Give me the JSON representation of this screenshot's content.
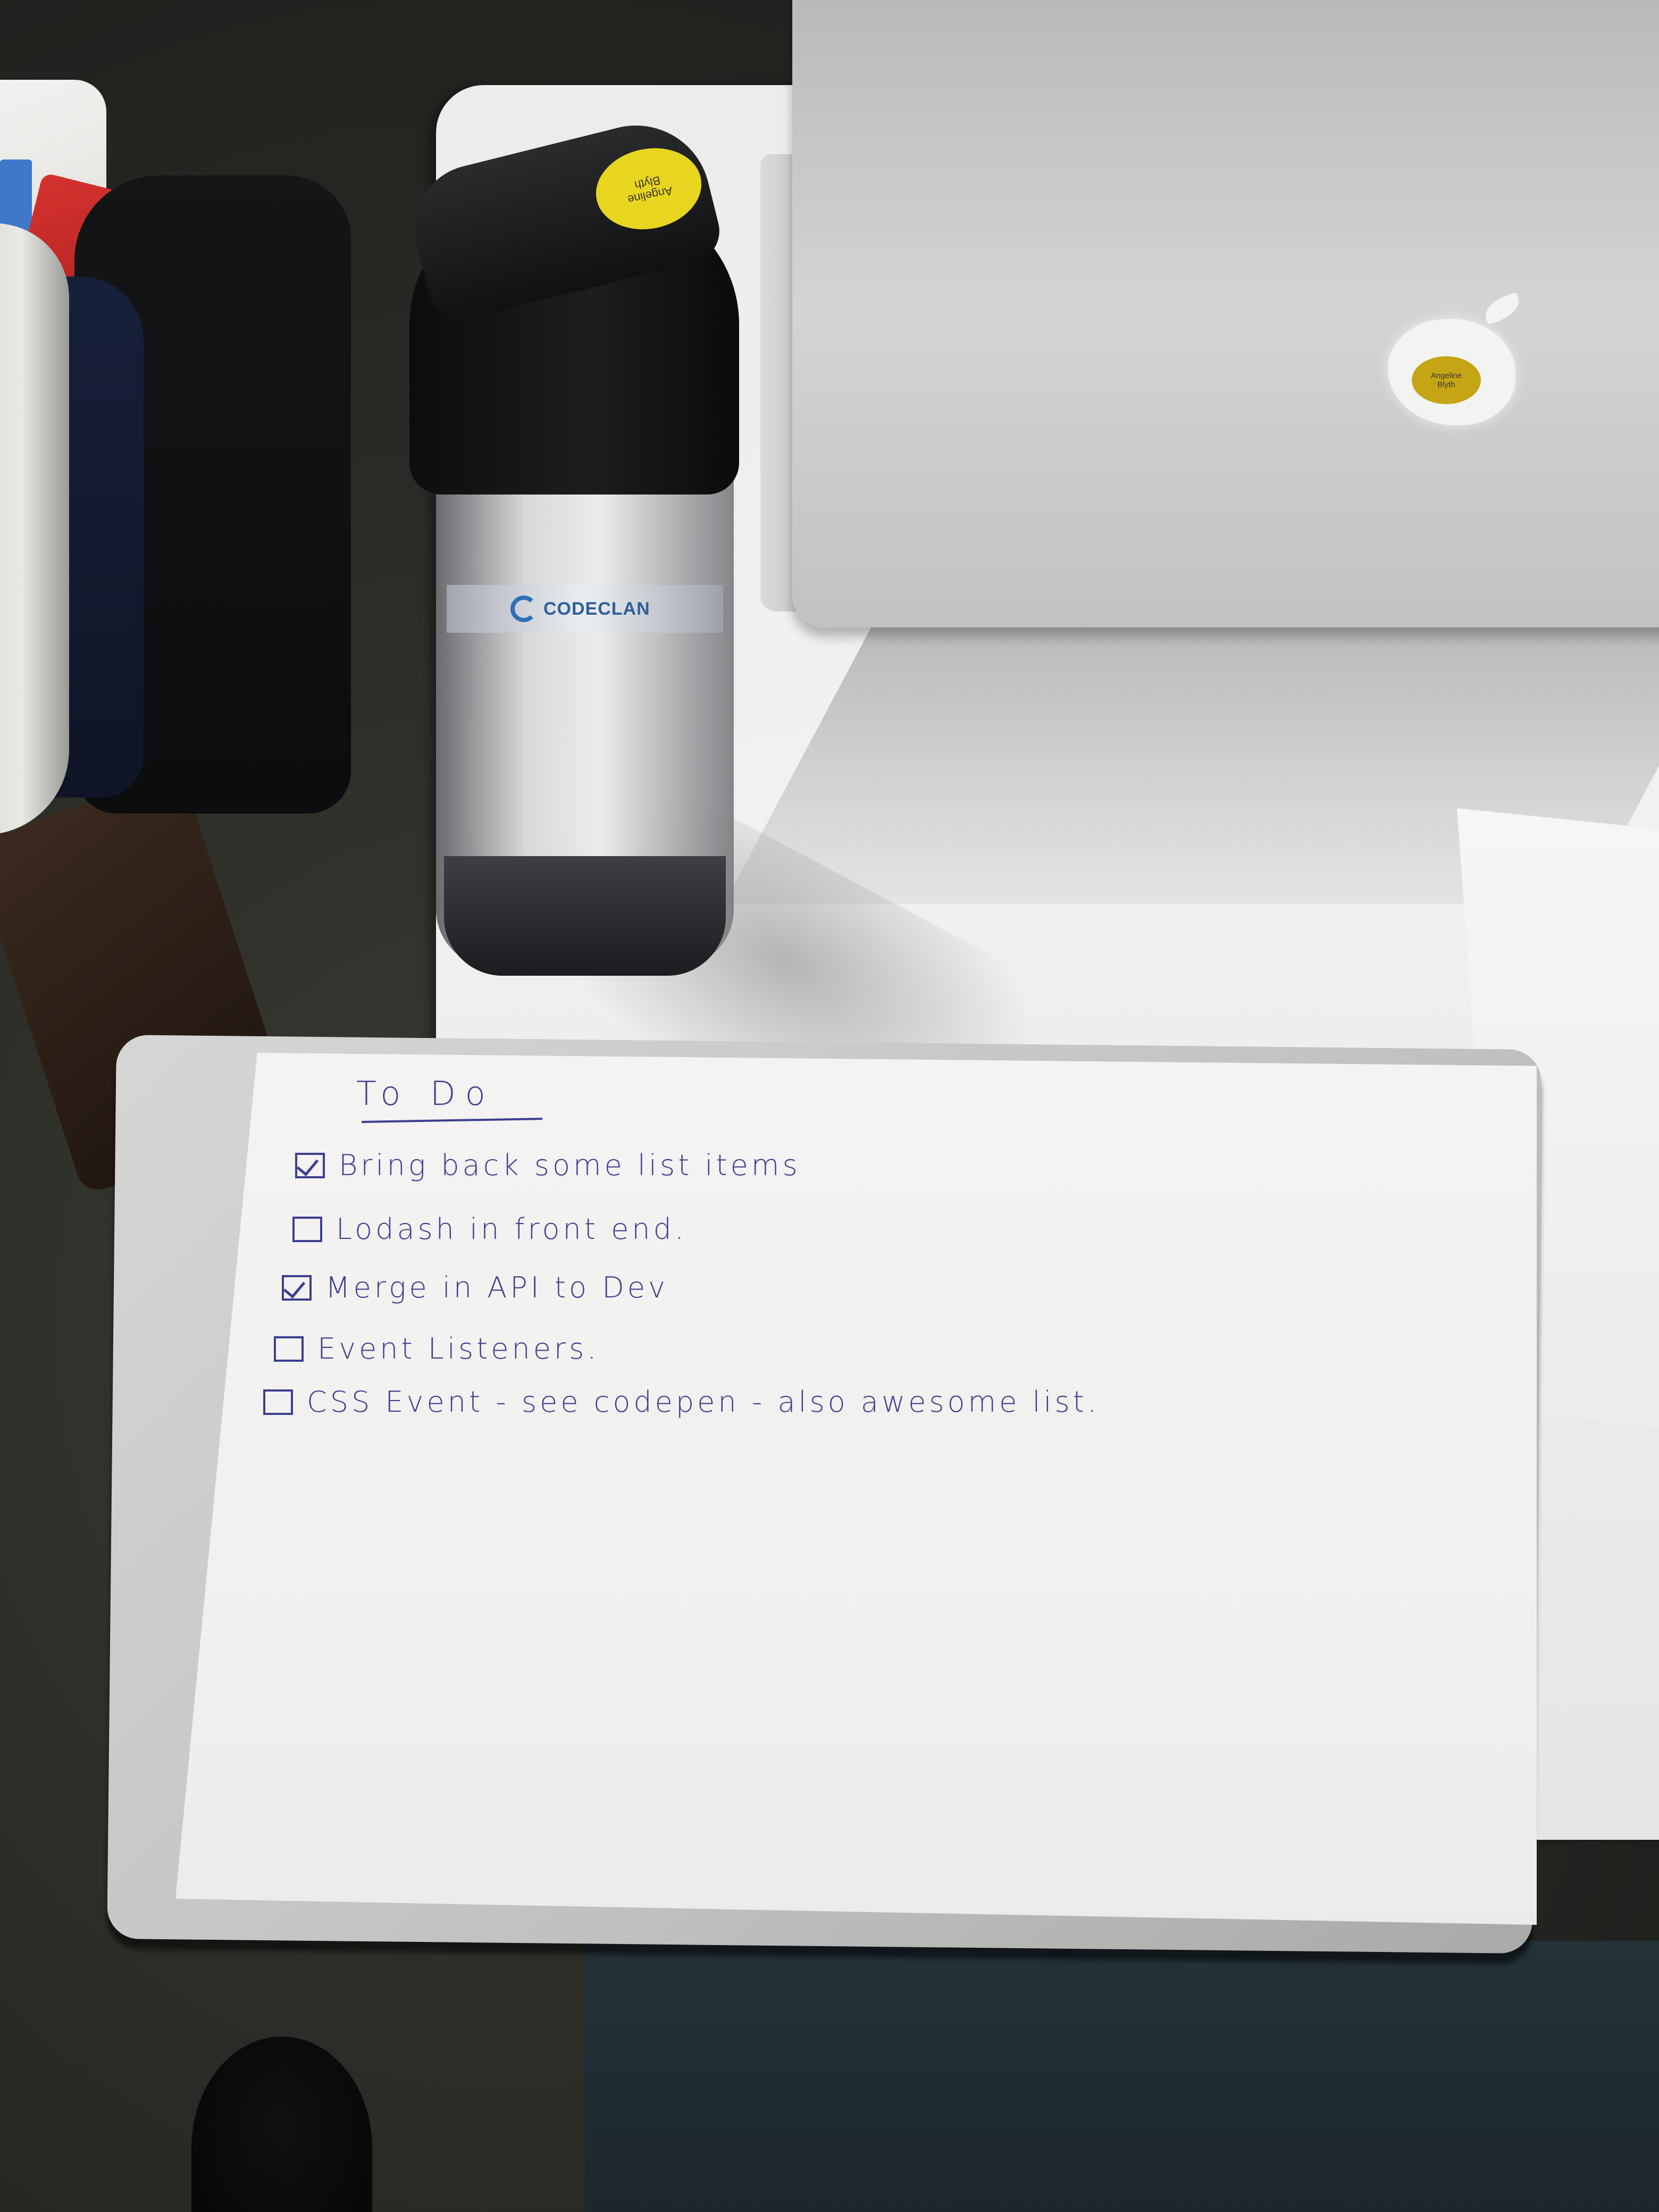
{
  "photo": {
    "laptop_sticker": {
      "line1": "Angeline",
      "line2": "Blyth"
    },
    "lid_sticker": {
      "line1": "Angeline",
      "line2": "Blyth"
    },
    "bottle_brand": "CODECLAN"
  },
  "todo": {
    "title": "To Do",
    "items": [
      {
        "text": "Bring back some list items",
        "checked": true
      },
      {
        "text": "Lodash in front end.",
        "checked": false
      },
      {
        "text": "Merge in API to Dev",
        "checked": true
      },
      {
        "text": "Event Listeners.",
        "checked": false
      },
      {
        "text": "CSS Event - see codepen - also awesome list.",
        "checked": false
      }
    ]
  },
  "colors": {
    "ink": "#3d3f8f",
    "table": "#ececeb",
    "laptop": "#c4c4c2",
    "sticker_yellow": "#e8d520"
  }
}
